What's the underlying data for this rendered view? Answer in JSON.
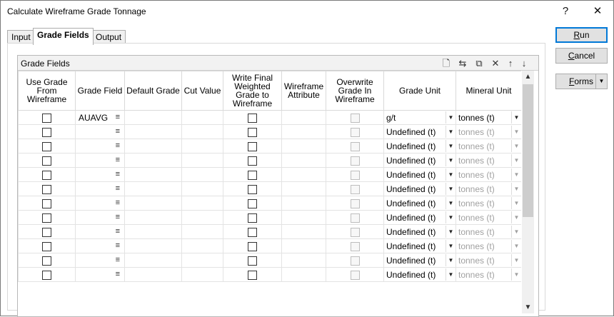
{
  "window": {
    "title": "Calculate Wireframe Grade Tonnage",
    "help_label": "?",
    "close_label": "✕"
  },
  "tabs": [
    {
      "label": "Input",
      "active": false
    },
    {
      "label": "Grade Fields",
      "active": true
    },
    {
      "label": "Output",
      "active": false
    }
  ],
  "group": {
    "title": "Grade Fields",
    "tools": [
      {
        "name": "new-row-icon",
        "glyph": "🗋"
      },
      {
        "name": "insert-row-icon",
        "glyph": "⇆"
      },
      {
        "name": "copy-row-icon",
        "glyph": "⧉"
      },
      {
        "name": "delete-row-icon",
        "glyph": "✕"
      },
      {
        "name": "move-up-icon",
        "glyph": "↑"
      },
      {
        "name": "move-down-icon",
        "glyph": "↓"
      }
    ]
  },
  "grid": {
    "columns": [
      "Use Grade From Wireframe",
      "Grade Field",
      "Default Grade",
      "Cut Value",
      "Write Final Weighted Grade to Wireframe",
      "Wireframe Attribute",
      "Overwrite Grade In Wireframe",
      "Grade Unit",
      "Mineral Unit"
    ],
    "field_button_glyph": "≡",
    "combo_arrow_glyph": "▼",
    "rows": [
      {
        "grade_field": "AUAVG",
        "grade_unit": "g/t",
        "mineral_unit": "tonnes (t)",
        "active": true
      },
      {
        "grade_field": "",
        "grade_unit": "Undefined (t)",
        "mineral_unit": "tonnes (t)",
        "active": false
      },
      {
        "grade_field": "",
        "grade_unit": "Undefined (t)",
        "mineral_unit": "tonnes (t)",
        "active": false
      },
      {
        "grade_field": "",
        "grade_unit": "Undefined (t)",
        "mineral_unit": "tonnes (t)",
        "active": false
      },
      {
        "grade_field": "",
        "grade_unit": "Undefined (t)",
        "mineral_unit": "tonnes (t)",
        "active": false
      },
      {
        "grade_field": "",
        "grade_unit": "Undefined (t)",
        "mineral_unit": "tonnes (t)",
        "active": false
      },
      {
        "grade_field": "",
        "grade_unit": "Undefined (t)",
        "mineral_unit": "tonnes (t)",
        "active": false
      },
      {
        "grade_field": "",
        "grade_unit": "Undefined (t)",
        "mineral_unit": "tonnes (t)",
        "active": false
      },
      {
        "grade_field": "",
        "grade_unit": "Undefined (t)",
        "mineral_unit": "tonnes (t)",
        "active": false
      },
      {
        "grade_field": "",
        "grade_unit": "Undefined (t)",
        "mineral_unit": "tonnes (t)",
        "active": false
      },
      {
        "grade_field": "",
        "grade_unit": "Undefined (t)",
        "mineral_unit": "tonnes (t)",
        "active": false
      },
      {
        "grade_field": "",
        "grade_unit": "Undefined (t)",
        "mineral_unit": "tonnes (t)",
        "active": false
      }
    ]
  },
  "scrollbar": {
    "up_glyph": "▲",
    "down_glyph": "▼"
  },
  "buttons": {
    "run": {
      "access_key": "R",
      "rest": "un"
    },
    "cancel": {
      "access_key": "C",
      "rest": "ancel"
    },
    "forms": {
      "access_key": "F",
      "rest": "orms",
      "arrow": "▼"
    }
  },
  "colors": {
    "accent": "#0078d7",
    "disabled_cell": "#f2f2f2",
    "disabled_text": "#a0a0a0"
  }
}
